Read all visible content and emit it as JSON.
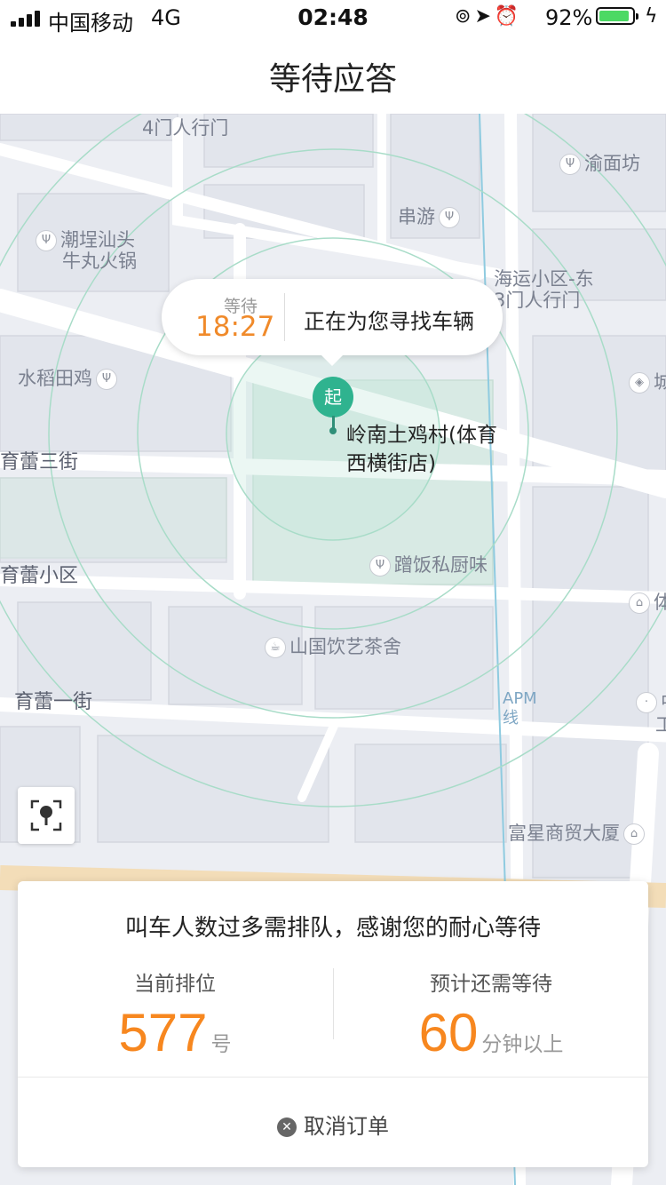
{
  "status_bar": {
    "carrier": "中国移动",
    "network": "4G",
    "time": "02:48",
    "battery_percent": "92%",
    "battery_level": 0.92,
    "icons": [
      "orientation-lock-icon",
      "location-arrow-icon",
      "alarm-icon",
      "battery-icon",
      "charging-icon"
    ]
  },
  "nav": {
    "title": "等待应答"
  },
  "bubble": {
    "wait_label": "等待",
    "wait_time": "18:27",
    "message": "正在为您寻找车辆"
  },
  "pin": {
    "badge": "起",
    "label": "岭南土鸡村(体育西横街店)"
  },
  "map_labels": {
    "gate4": "4门人行门",
    "yumianfang": "渝面坊",
    "chuanyou": "串游",
    "chaocheng": "潮埕汕头",
    "chaocheng2": "牛丸火锅",
    "haiyun": "海运小区-东",
    "haiyun2": "3门人行门",
    "shuidao": "水稻田鸡",
    "yulei3": "育蕾三街",
    "yulei_xiaoqu": "育蕾小区",
    "cengfan": "蹭饭私厨味",
    "shanguo": "山国饮艺茶舍",
    "yulei1": "育蕾一街",
    "apm": "APM线",
    "fuxing": "富星商贸大厦",
    "edge_cheng": "城",
    "edge_ti": "体",
    "edge_zhong": "中",
    "edge_gong": "工"
  },
  "card": {
    "title": "叫车人数过多需排队，感谢您的耐心等待",
    "queue_label": "当前排位",
    "queue_number": "577",
    "queue_unit": "号",
    "eta_label": "预计还需等待",
    "eta_number": "60",
    "eta_unit": "分钟以上",
    "cancel_label": "取消订单"
  },
  "colors": {
    "accent_orange": "#f7871f",
    "pin_green": "#2fb38f",
    "timer_orange": "#f08a2a"
  }
}
